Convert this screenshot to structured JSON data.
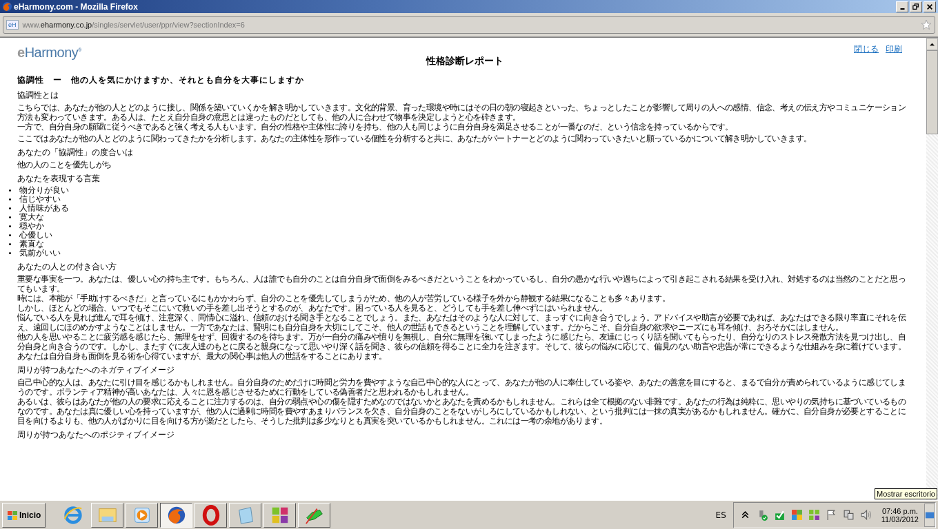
{
  "window": {
    "title": "eHarmony.com - Mozilla Firefox"
  },
  "address_bar": {
    "favicon": "eH",
    "url_start": "www.",
    "url_domain": "eharmony.co.jp",
    "url_rest": "/singles/servlet/user/ppr/view?sectionIndex=6"
  },
  "page": {
    "logo": {
      "prefix": "e",
      "name": "Harmony",
      "mark": "®"
    },
    "links": [
      "閉じる",
      "印刷"
    ],
    "title": "性格診断レポート",
    "section_title": "協調性　ー　他の人を気にかけますか、それとも自分を大事にしますか",
    "sections": [
      {
        "kind": "text",
        "heading": "協調性とは",
        "paragraphs": [
          [
            "こちらでは、あなたが他の人とどのように接し、関係を築いていくかを解き明かしていきます。文化的背景、育った環境や時にはその日の朝の寝起きといった、ちょっとしたことが影響して周りの人への感情、信念、考えの伝え方やコミュニケーション方法も変わっていきます。ある人は、たとえ自分自身の意思とは違ったものだとしても、他の人に合わせて物事を決定しようと心を砕きます。",
            "一方で、自分自身の願望に従うべきであると強く考える人もいます。自分の性格や主体性に誇りを持ち、他の人も同じように自分自身を満足させることが一番なのだ、という信念を持っているからです。"
          ],
          [
            "ここではあなたが他の人とどのように関わってきたかを分析します。あなたの主体性を形作っている個性を分析すると共に、あなたがパートナーとどのように関わっていきたいと願っているかについて解き明かしていきます。"
          ]
        ]
      },
      {
        "kind": "text",
        "heading": "あなたの「協調性」の度合いは",
        "paragraphs": [
          [
            "他の人のことを優先しがち"
          ]
        ]
      },
      {
        "kind": "list",
        "heading": "あなたを表現する言葉",
        "items": [
          "物分りが良い",
          "信じやすい",
          "人情味がある",
          "寛大な",
          "穏やか",
          "心優しい",
          "素直な",
          "気前がいい"
        ]
      },
      {
        "kind": "text",
        "heading": "あなたの人との付き合い方",
        "paragraphs": [
          [
            "重要な事実を一つ。あなたは、優しい心の持ち主です。もちろん、人は誰でも自分のことは自分自身で面倒をみるべきだということをわかっているし、自分の愚かな行いや過ちによって引き起こされる結果を受け入れ、対処するのは当然のことだと思ってもいます。",
            "時には、本能が「手助けするべきだ」と言っているにもかかわらず、自分のことを優先してしまうがため、他の人が苦労している様子を外から静観する結果になることも多々あります。",
            "しかし、ほとんどの場合、いつでもそこにいて救いの手を差し出そうとするのが、あなたです。困っている人を見ると、どうしても手を差し伸べずにはいられません。",
            "悩んでいる人を見れば進んで耳を傾け、注意深く、同情心に溢れ、信頼のおける聞き手となることでしょう。また、あなたはそのような人に対して、まっすぐに向き合うでしょう。アドバイスや助言が必要であれば、あなたはできる限り率直にそれを伝え、遠回しにほのめかすようなことはしません。一方であなたは、賢明にも自分自身を大切にしてこそ、他人の世話もできるということを理解しています。だからこそ、自分自身の欲求やニーズにも耳を傾け、おろそかにはしません。",
            "他の人を思いやることに疲労感を感じたら、無理をせず、回復するのを待ちます。万が一自分の痛みや憤りを無視し、自分に無理を強いてしまったように感じたら、友達にじっくり話を聞いてもらったり、自分なりのストレス発散方法を見つけ出し、自分自身と向き合うのです。しかし、またすぐに友人達のもとに戻ると親身になって思いやり深く話を聞き、彼らの信頼を得ることに全力を注ぎます。そして、彼らの悩みに応じて、偏見のない助言や忠告が常にできるような仕組みを身に着けています。あなたは自分自身も面倒を見る術を心得ていますが、最大の関心事は他人の世話をすることにあります。"
          ]
        ]
      },
      {
        "kind": "text",
        "heading": "周りが持つあなたへのネガティブイメージ",
        "paragraphs": [
          [
            "自己中心的な人は、あなたに引け目を感じるかもしれません。自分自身のためだけに時間と労力を費やすような自己中心的な人にとって、あなたが他の人に奉仕している姿や、あなたの善意を目にすると、まるで自分が責められているように感じてしまうのです。ボランティア精神が高いあなたは、人々に恩を感じさせるために行動をしている偽善者だと思われるかもしれません。",
            "あるいは、彼らはあなたが他の人の要求に応えることに注力するのは、自分の弱点や心の傷を隠すためなのではないかとあなたを責めるかもしれません。これらは全て根拠のない非難です。あなたの行為は純粋に、思いやりの気持ちに基づいているものなのです。あなたは真に優しい心を持っていますが、他の人に過剰に時間を費やすあまりバランスを欠き、自分自身のことをないがしろにしているかもしれない、という批判には一抹の真実があるかもしれません。確かに、自分自身が必要とすることに目を向けるよりも、他の人がばかりに目を向ける方が楽だとしたら、そうした批判は多少なりとも真実を突いているかもしれません。これには一考の余地があります。"
          ]
        ]
      },
      {
        "kind": "text",
        "heading": "周りが持つあなたへのポジティブイメージ"
      }
    ]
  },
  "tooltip": "Mostrar escritorio",
  "taskbar": {
    "start": "Inicio",
    "apps": [
      {
        "kind": "ie",
        "selected": false
      },
      {
        "kind": "explorer",
        "selected": false
      },
      {
        "kind": "media",
        "selected": false
      },
      {
        "kind": "firefox",
        "selected": true
      },
      {
        "kind": "opera",
        "selected": false
      },
      {
        "kind": "notepad",
        "selected": false
      },
      {
        "kind": "tiles",
        "selected": false
      },
      {
        "kind": "paint",
        "selected": false
      }
    ],
    "language": "ES",
    "tray": [
      {
        "kind": "expand"
      },
      {
        "kind": "usb"
      },
      {
        "kind": "shield"
      },
      {
        "kind": "grid"
      },
      {
        "kind": "squares"
      },
      {
        "kind": "flag"
      },
      {
        "kind": "network"
      },
      {
        "kind": "speaker"
      }
    ],
    "clock": {
      "time": "07:46 p.m.",
      "date": "11/03/2012"
    }
  }
}
